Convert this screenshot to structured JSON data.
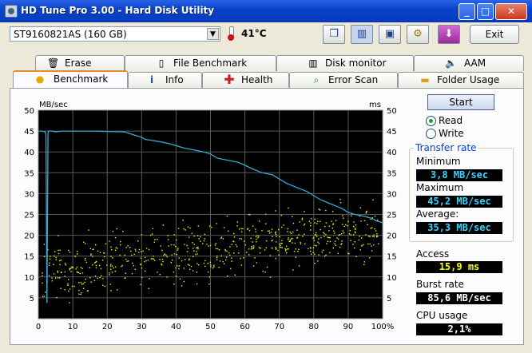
{
  "window": {
    "title": "HD Tune Pro 3.00 - Hard Disk Utility"
  },
  "toolbar": {
    "drive": "ST9160821AS (160 GB)",
    "temperature": "41°C",
    "tools": [
      "copy-icon",
      "compare-icon",
      "save-icon",
      "options-icon",
      "download-icon"
    ],
    "exit_label": "Exit"
  },
  "tabs": {
    "row1": [
      "Erase",
      "File Benchmark",
      "Disk monitor",
      "AAM"
    ],
    "row2": [
      "Benchmark",
      "Info",
      "Health",
      "Error Scan",
      "Folder Usage"
    ],
    "active": "Benchmark"
  },
  "chart_data": {
    "type": "line",
    "left_unit": "MB/sec",
    "right_unit": "ms",
    "ylim": [
      0,
      50
    ],
    "y_ticks": [
      5,
      10,
      15,
      20,
      25,
      30,
      35,
      40,
      45,
      50
    ],
    "xlim": [
      0,
      100
    ],
    "x_ticks": [
      "0",
      "10",
      "20",
      "30",
      "40",
      "50",
      "60",
      "70",
      "80",
      "90",
      "100%"
    ],
    "grid": true,
    "colors": {
      "background": "#000000",
      "grid": "#5a5a5a",
      "transfer": "#39a7d6",
      "access": "#f4f400"
    },
    "series": [
      {
        "name": "Read",
        "style": "line",
        "x": [
          0,
          1,
          2,
          3,
          4,
          5,
          7,
          10,
          15,
          20,
          25,
          28,
          30,
          31,
          35,
          38,
          40,
          42,
          45,
          48,
          50,
          52,
          55,
          58,
          60,
          62,
          65,
          68,
          70,
          72,
          75,
          78,
          80,
          82,
          85,
          88,
          90,
          92,
          95,
          97,
          98,
          100
        ],
        "y": [
          45,
          45,
          44.8,
          45,
          45,
          44.8,
          45,
          45,
          45,
          44.9,
          44.8,
          44,
          43.5,
          43,
          42.5,
          42,
          41.5,
          41,
          40.5,
          40,
          39.5,
          38.5,
          38,
          37.5,
          36.8,
          36,
          35,
          34.5,
          33.5,
          32.5,
          31.5,
          30.5,
          29.5,
          28.5,
          27.5,
          26.5,
          25.5,
          25,
          24.5,
          24,
          23.5,
          23
        ]
      }
    ]
  },
  "controls": {
    "start_label": "Start",
    "read_label": "Read",
    "write_label": "Write",
    "mode_selected": "Read"
  },
  "stats": {
    "transfer_title": "Transfer rate",
    "minimum_label": "Minimum",
    "minimum_value": "3,8 MB/sec",
    "maximum_label": "Maximum",
    "maximum_value": "45,2 MB/sec",
    "average_label": "Average:",
    "average_value": "35,3 MB/sec",
    "access_label": "Access",
    "access_value": "15,9 ms",
    "burst_label": "Burst rate",
    "burst_value": "85,6 MB/sec",
    "cpu_label": "CPU usage",
    "cpu_value": "2,1%"
  }
}
